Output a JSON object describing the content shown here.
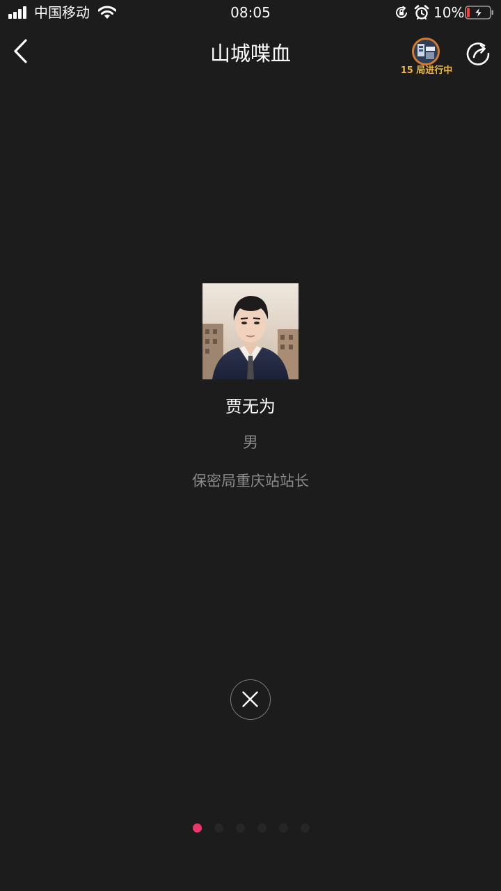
{
  "status_bar": {
    "carrier": "中国移动",
    "time": "08:05",
    "battery_percent": "10%",
    "battery_level": 0.1,
    "icons": [
      "signal-icon",
      "wifi-icon",
      "rotation-lock-icon",
      "alarm-icon",
      "battery-icon"
    ]
  },
  "header": {
    "back_icon": "chevron-left-icon",
    "title": "山城喋血",
    "game_badge_label": "15 局进行中",
    "share_icon": "share-icon"
  },
  "character": {
    "name": "贾无为",
    "gender": "男",
    "role": "保密局重庆站站长"
  },
  "close_icon": "close-icon",
  "pager": {
    "count": 6,
    "active_index": 0
  },
  "colors": {
    "background": "#1c1c1c",
    "accent_dot": "#f0356a",
    "badge_text": "#f0b63a",
    "secondary_text": "#8a8a8a"
  }
}
